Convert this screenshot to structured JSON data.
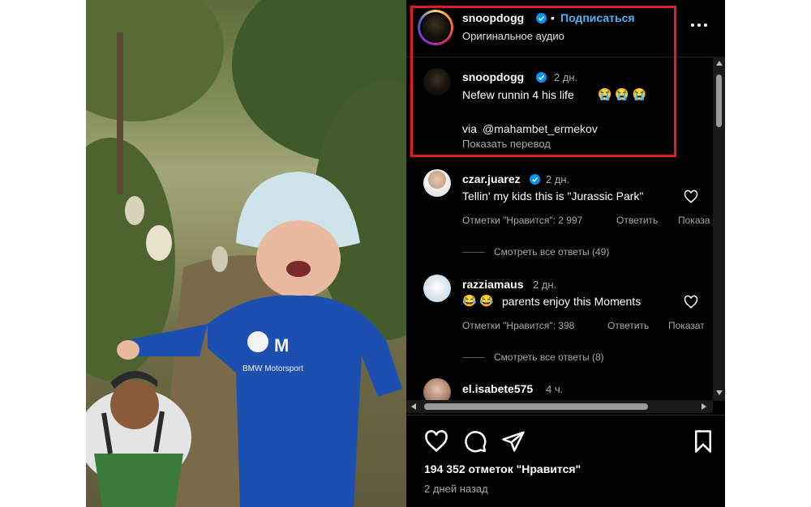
{
  "post": {
    "author": "snoopdogg",
    "follow_label": "Подписаться",
    "separator": "•",
    "audio_label": "Оригинальное аудио",
    "more_icon": "more-horizontal-icon"
  },
  "caption": {
    "author": "snoopdogg",
    "time": "2 дн.",
    "text": "Nefew runnin 4 his life",
    "emojis": "😭 😭 😭",
    "via_label": "via",
    "mention": "@mahambet_ermekov",
    "translate_label": "Показать перевод"
  },
  "comments": [
    {
      "author": "czar.juarez",
      "verified": true,
      "time": "2 дн.",
      "text": "Tellin' my kids this is \"Jurassic Park\"",
      "likes": "Отметки \"Нравится\": 2 997",
      "reply_label": "Ответить",
      "translate_label": "Показа",
      "view_replies": "Смотреть все ответы (49)"
    },
    {
      "author": "razziamaus",
      "verified": false,
      "time": "2 дн.",
      "emojis": "😂 😂",
      "text": "parents enjoy this Moments",
      "likes": "Отметки \"Нравится\": 398",
      "reply_label": "Ответить",
      "translate_label": "Показат",
      "view_replies": "Смотреть все ответы (8)"
    },
    {
      "author": "el.isabete575",
      "verified": false,
      "time": "4 ч."
    }
  ],
  "footer": {
    "likes_count": "194 352 отметок \"Нравится\"",
    "posted": "2 дней назад",
    "icons": [
      "heart-icon",
      "comment-icon",
      "share-icon",
      "bookmark-icon"
    ]
  },
  "media": {
    "shirt_brand": "BMW Motorsport",
    "logo_text": "M"
  },
  "colors": {
    "accent_blue": "#4cb5f9",
    "highlight_red": "#e31b1b",
    "background": "#000000"
  }
}
